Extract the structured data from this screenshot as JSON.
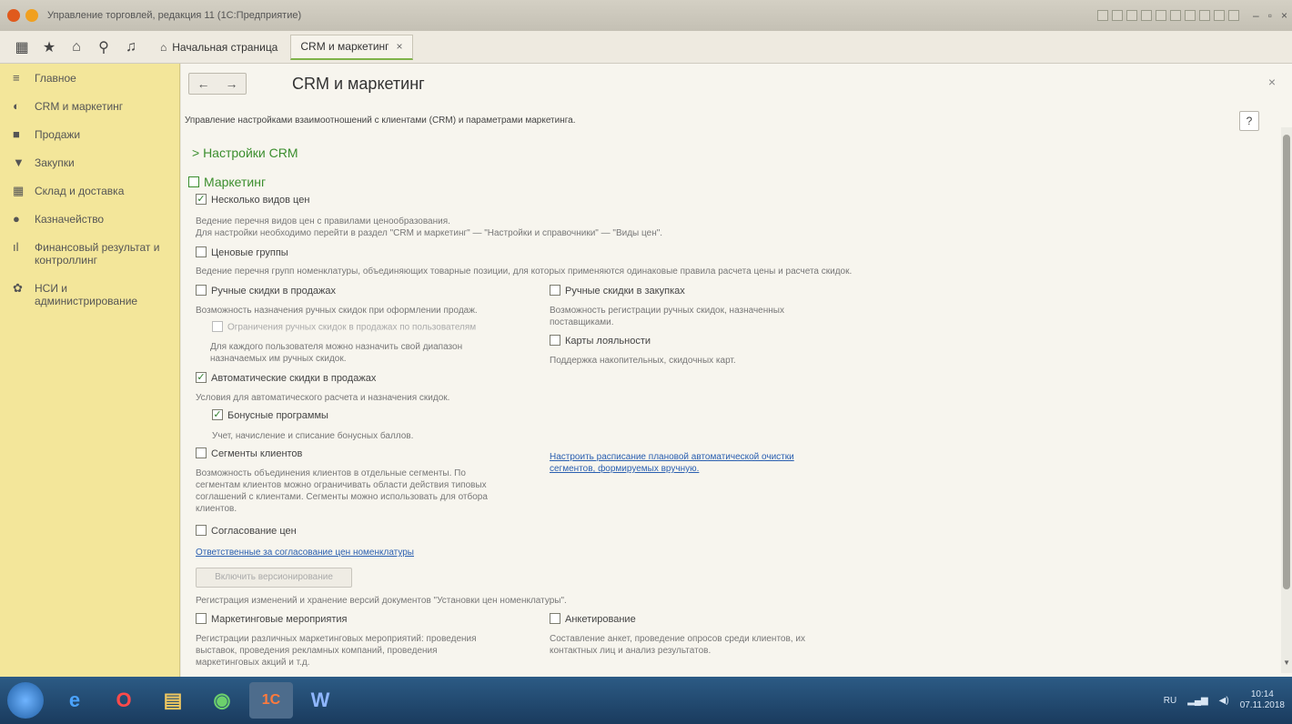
{
  "window": {
    "title": "Управление торговлей, редакция 11 (1С:Предприятие)",
    "minimize": "–",
    "maximize": "▫",
    "close": "×"
  },
  "navbar": {
    "tabs": [
      {
        "label": "Начальная страница"
      },
      {
        "label": "CRM и маркетинг",
        "close": "×"
      }
    ]
  },
  "sidebar": {
    "items": [
      {
        "label": "Главное",
        "icon": "menu-icon",
        "glyph": "≡"
      },
      {
        "label": "CRM и маркетинг",
        "icon": "crm-icon",
        "glyph": "◐"
      },
      {
        "label": "Продажи",
        "icon": "bag-icon",
        "glyph": "■"
      },
      {
        "label": "Закупки",
        "icon": "cart-icon",
        "glyph": "▼"
      },
      {
        "label": "Склад и доставка",
        "icon": "warehouse-icon",
        "glyph": "▦"
      },
      {
        "label": "Казначейство",
        "icon": "coin-icon",
        "glyph": "●"
      },
      {
        "label": "Финансовый результат и контроллинг",
        "icon": "chart-icon",
        "glyph": "ıl"
      },
      {
        "label": "НСИ и администрирование",
        "icon": "gear-icon",
        "glyph": "✿"
      }
    ]
  },
  "page": {
    "back": "←",
    "forward": "→",
    "title": "CRM и маркетинг",
    "close": "×",
    "help": "?",
    "intro": "Управление настройками взаимоотношений с клиентами (CRM) и параметрами маркетинга.",
    "section_crm": "> Настройки CRM",
    "section_marketing": "Маркетинг",
    "check": "✓",
    "options": {
      "price_types": {
        "label": "Несколько видов цен",
        "checked": true,
        "desc1": "Ведение перечня видов цен с правилами ценообразования.",
        "desc2": "Для настройки необходимо перейти в раздел \"CRM и маркетинг\" — \"Настройки и справочники\" — \"Виды цен\"."
      },
      "price_groups": {
        "label": "Ценовые группы",
        "checked": false,
        "desc": "Ведение перечня групп номенклатуры, объединяющих товарные позиции, для которых применяются одинаковые правила расчета цены и расчета скидок."
      },
      "manual_sales": {
        "label": "Ручные скидки в продажах",
        "checked": false,
        "desc": "Возможность назначения ручных скидок при оформлении продаж."
      },
      "manual_limits": {
        "label": "Ограничения ручных скидок в продажах по пользователям",
        "checked": false,
        "desc1": "Для каждого пользователя можно назначить свой диапазон",
        "desc2": "назначаемых им ручных скидок."
      },
      "manual_purchases": {
        "label": "Ручные скидки в закупках",
        "checked": false,
        "desc1": "Возможность регистрации ручных скидок, назначенных",
        "desc2": "поставщиками."
      },
      "loyalty": {
        "label": "Карты лояльности",
        "checked": false,
        "desc": "Поддержка накопительных, скидочных карт."
      },
      "auto_discounts": {
        "label": "Автоматические скидки в продажах",
        "checked": true,
        "desc": "Условия для автоматического расчета и назначения скидок."
      },
      "bonus": {
        "label": "Бонусные программы",
        "checked": true,
        "desc": "Учет, начисление и списание бонусных баллов."
      },
      "segments": {
        "label": "Сегменты клиентов",
        "checked": false,
        "desc1": "Возможность объединения клиентов в отдельные сегменты. По",
        "desc2": "сегментам клиентов можно ограничивать области действия типовых",
        "desc3": "соглашений с клиентами. Сегменты можно использовать для отбора",
        "desc4": "клиентов."
      },
      "segments_link1": "Настроить расписание плановой автоматической очистки",
      "segments_link2": "сегментов, формируемых вручную.",
      "price_approval": {
        "label": "Согласование цен",
        "checked": false
      },
      "approval_link": "Ответственные за согласование цен номенклатуры",
      "versioning_button": "Включить версионирование",
      "versioning_desc": "Регистрация изменений и хранение версий документов \"Установки цен номенклатуры\".",
      "events": {
        "label": "Маркетинговые мероприятия",
        "checked": false,
        "desc1": "Регистрации различных маркетинговых мероприятий: проведения",
        "desc2": "выставок, проведения рекламных компаний, проведения",
        "desc3": "маркетинговых акций и т.д."
      },
      "surveys": {
        "label": "Анкетирование",
        "checked": false,
        "desc1": "Составление анкет, проведение опросов среди клиентов, их",
        "desc2": "контактных лиц и анализ результатов."
      }
    }
  },
  "taskbar": {
    "apps": [
      {
        "name": "ie",
        "glyph": "e",
        "color": "#1e6fc7"
      },
      {
        "name": "opera",
        "glyph": "O",
        "color": "#d42a2a"
      },
      {
        "name": "explorer",
        "glyph": "▤",
        "color": "#d8b04a"
      },
      {
        "name": "chrome",
        "glyph": "◉",
        "color": "#3c9b45"
      },
      {
        "name": "1c",
        "glyph": "1С",
        "color": "#e05a1c"
      },
      {
        "name": "word",
        "glyph": "W",
        "color": "#2b5797"
      }
    ],
    "lang": "RU",
    "time": "10:14",
    "date": "07.11.2018"
  }
}
